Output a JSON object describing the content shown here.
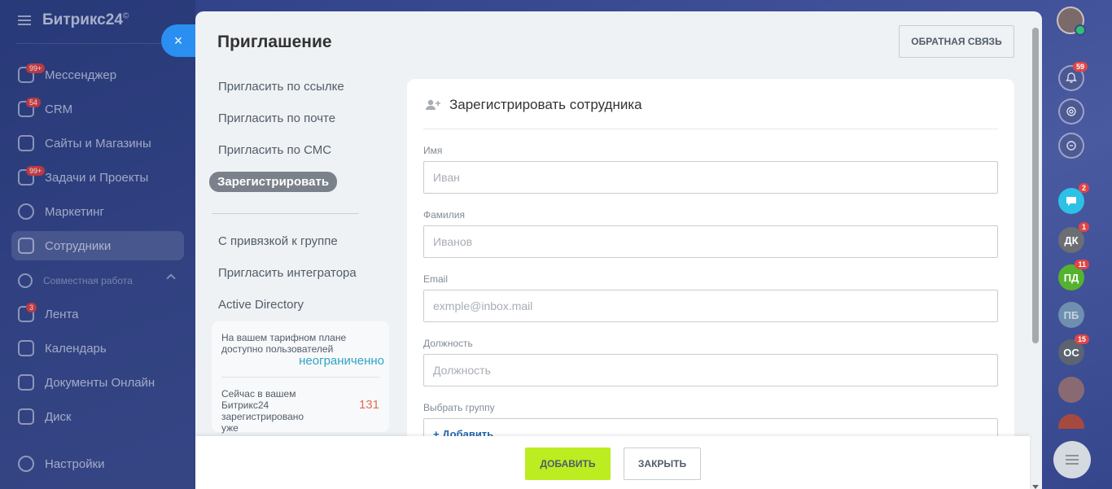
{
  "sidebar": {
    "brand": "Битрикс24",
    "brand_mark": "©",
    "items": [
      {
        "label": "Мессенджер",
        "badge": "99+"
      },
      {
        "label": "CRM",
        "badge": "54"
      },
      {
        "label": "Сайты и Магазины",
        "badge": ""
      },
      {
        "label": "Задачи и Проекты",
        "badge": "99+"
      },
      {
        "label": "Маркетинг",
        "badge": ""
      },
      {
        "label": "Сотрудники",
        "badge": ""
      },
      {
        "label": "Совместная работа",
        "badge": ""
      },
      {
        "label": "Лента",
        "badge": "3"
      },
      {
        "label": "Календарь",
        "badge": ""
      },
      {
        "label": "Документы Онлайн",
        "badge": ""
      },
      {
        "label": "Диск",
        "badge": ""
      },
      {
        "label": "Настройки",
        "badge": ""
      }
    ]
  },
  "close_icon": "×",
  "modal": {
    "title": "Приглашение",
    "feedback_label": "ОБРАТНАЯ СВЯЗЬ",
    "menu": [
      "Пригласить по ссылке",
      "Пригласить по почте",
      "Пригласить по СМС",
      "Зарегистрировать",
      "С привязкой к группе",
      "Пригласить интегратора",
      "Active Directory"
    ],
    "info": {
      "plan_text": "На вашем тарифном плане доступно пользователей",
      "plan_value": "неограниченно",
      "registered_text": "Сейчас в вашем Битрикс24 зарегистрировано уже",
      "registered_value": "131"
    },
    "form": {
      "heading": "Зарегистрировать сотрудника",
      "first_name_label": "Имя",
      "first_name_placeholder": "Иван",
      "last_name_label": "Фамилия",
      "last_name_placeholder": "Иванов",
      "email_label": "Email",
      "email_placeholder": "exmple@inbox.mail",
      "position_label": "Должность",
      "position_placeholder": "Должность",
      "group_label": "Выбрать группу",
      "group_add": "+ Добавить"
    },
    "footer": {
      "add_label": "ДОБАВИТЬ",
      "close_label": "ЗАКРЫТЬ"
    }
  },
  "rightbar": {
    "items": [
      {
        "name": "notifications",
        "badge": "59"
      },
      {
        "name": "ДК",
        "badge": "1",
        "color": "#6b6e73"
      },
      {
        "name": "ПД",
        "badge": "11",
        "color": "#55b22f"
      },
      {
        "name": "ПБ",
        "badge": "",
        "color": "#6f8fb0"
      },
      {
        "name": "ОС",
        "badge": "15",
        "color": "#5b6470"
      },
      {
        "name": "chat",
        "badge": "2"
      }
    ]
  }
}
